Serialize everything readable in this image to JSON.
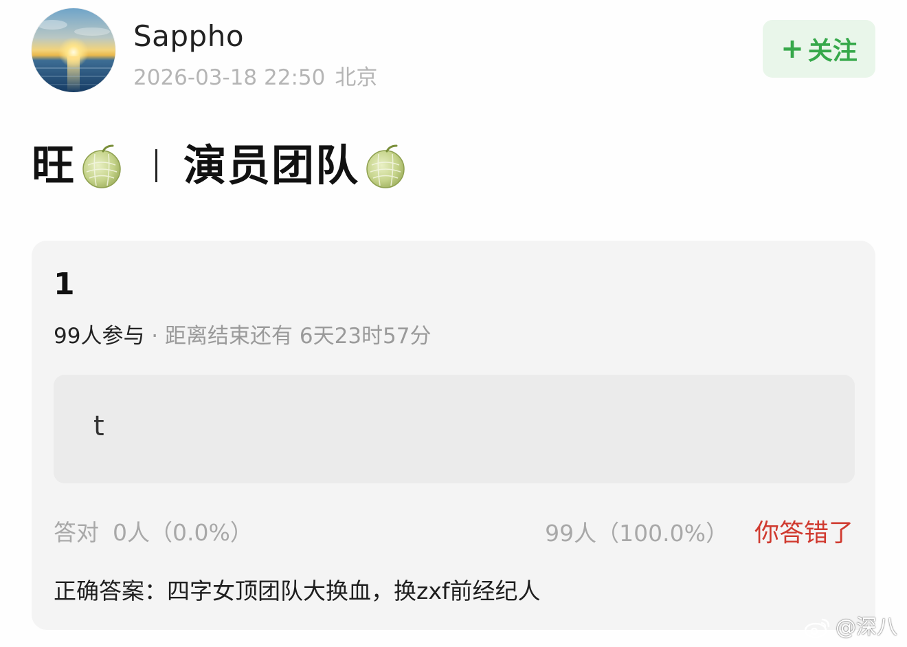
{
  "post": {
    "username": "Sappho",
    "datetime": "2026-03-18 22:50",
    "location": "北京",
    "follow_label": "关注",
    "follow_plus": "+",
    "title_part1": "旺",
    "title_separator": "｜",
    "title_part2": "演员团队",
    "title_emoji": "melon-emoji"
  },
  "quiz": {
    "number": "1",
    "participants": "99人参与",
    "time_left": " · 距离结束还有 6天23时57分",
    "option_text": "t",
    "correct_label": "答对",
    "correct_stats": "0人（0.0%）",
    "wrong_stats": "99人（100.0%）",
    "wrong_label": "你答错了",
    "answer": "正确答案：四字女顶团队大换血，换zxf前经纪人"
  },
  "watermark": {
    "text": "@深八"
  },
  "colors": {
    "follow_bg": "#e9f6ea",
    "follow_text": "#36a84a",
    "wrong_red": "#d03a2f",
    "card_bg": "#f4f4f4",
    "option_bg": "#ebebeb",
    "meta_gray": "#b5b5b5"
  }
}
